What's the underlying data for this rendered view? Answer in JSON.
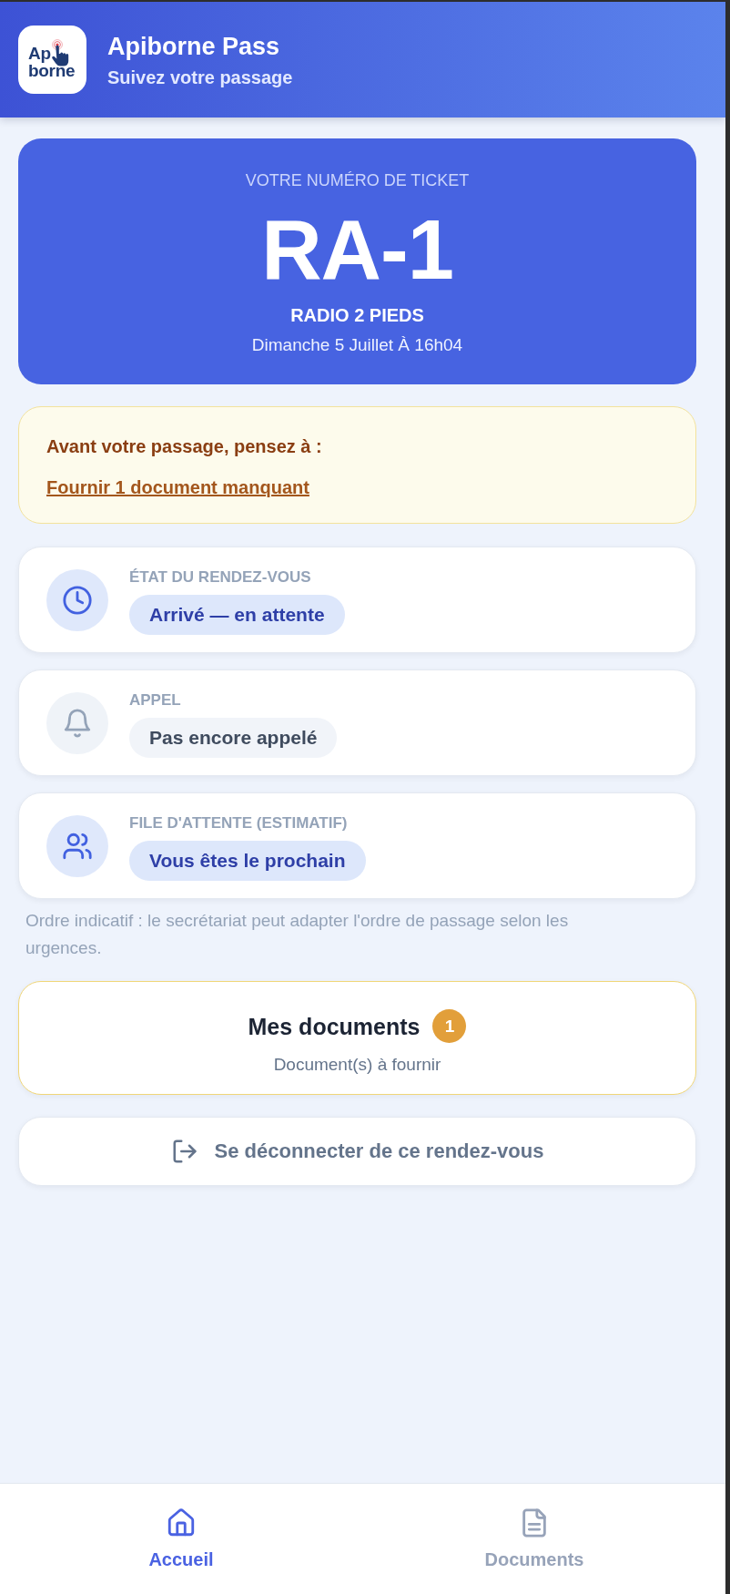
{
  "header": {
    "logo": {
      "line_1": "Ap",
      "line_2": "borne"
    },
    "title": "Apiborne Pass",
    "subtitle": "Suivez votre passage"
  },
  "ticket": {
    "label": "VOTRE NUMÉRO DE TICKET",
    "number": "RA-1",
    "service": "RADIO 2 PIEDS",
    "date": "Dimanche 5 Juillet À 16h04"
  },
  "reminder": {
    "title": "Avant votre passage, pensez à :",
    "link": "Fournir 1 document manquant"
  },
  "status_cards": [
    {
      "kind": "clock",
      "label": "ÉTAT DU RENDEZ-VOUS",
      "value": "Arrivé — en attente",
      "active": true
    },
    {
      "kind": "bell",
      "label": "APPEL",
      "value": "Pas encore appelé",
      "active": false
    },
    {
      "kind": "users",
      "label": "FILE D'ATTENTE (ESTIMATIF)",
      "value": "Vous êtes le prochain",
      "active": true
    }
  ],
  "queue_note": "Ordre indicatif : le secrétariat peut adapter l'ordre de passage selon les urgences.",
  "documents_card": {
    "title": "Mes documents",
    "badge": "1",
    "subtitle": "Document(s) à fournir"
  },
  "logout_button": {
    "label": "Se déconnecter de ce rendez-vous"
  },
  "bottom_nav": [
    {
      "kind": "home",
      "label": "Accueil",
      "selected": true
    },
    {
      "kind": "document",
      "label": "Documents",
      "selected": false
    }
  ]
}
